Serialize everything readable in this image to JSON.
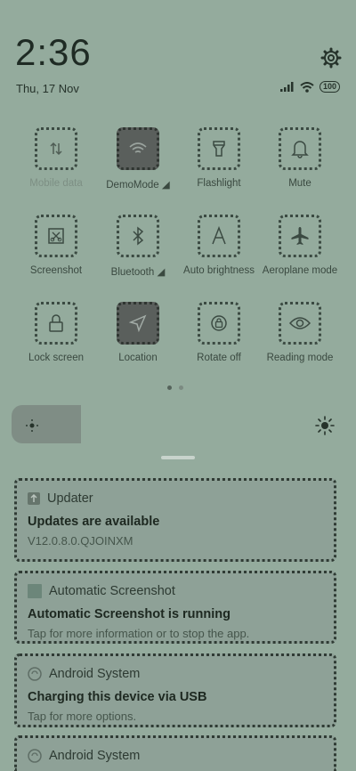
{
  "header": {
    "time": "2:36",
    "date": "Thu, 17 Nov",
    "battery": "100"
  },
  "tiles": [
    {
      "label": "Mobile data",
      "icon": "mobile-data-icon"
    },
    {
      "label": "DemoMode",
      "icon": "wifi-icon"
    },
    {
      "label": "Flashlight",
      "icon": "flashlight-icon"
    },
    {
      "label": "Mute",
      "icon": "bell-icon"
    },
    {
      "label": "Screenshot",
      "icon": "screenshot-icon"
    },
    {
      "label": "Bluetooth",
      "icon": "bluetooth-icon"
    },
    {
      "label": "Auto brightness",
      "icon": "auto-brightness-icon"
    },
    {
      "label": "Aeroplane mode",
      "icon": "aeroplane-icon"
    },
    {
      "label": "Lock screen",
      "icon": "lock-icon"
    },
    {
      "label": "Location",
      "icon": "location-icon"
    },
    {
      "label": "Rotate off",
      "icon": "rotate-icon"
    },
    {
      "label": "Reading mode",
      "icon": "eye-icon"
    }
  ],
  "notifications": [
    {
      "app": "Updater",
      "title": "Updates are available",
      "text": "V12.0.8.0.QJOINXM"
    },
    {
      "app": "Automatic Screenshot",
      "title": "Automatic Screenshot is running",
      "text": "Tap for more information or to stop the app."
    },
    {
      "app": "Android System",
      "title": "Charging this device via USB",
      "text": "Tap for more options."
    },
    {
      "app": "Android System",
      "title": "",
      "text": ""
    }
  ],
  "colors": {
    "background": "#94ab9d",
    "active_tile": "#5a5f5c"
  }
}
